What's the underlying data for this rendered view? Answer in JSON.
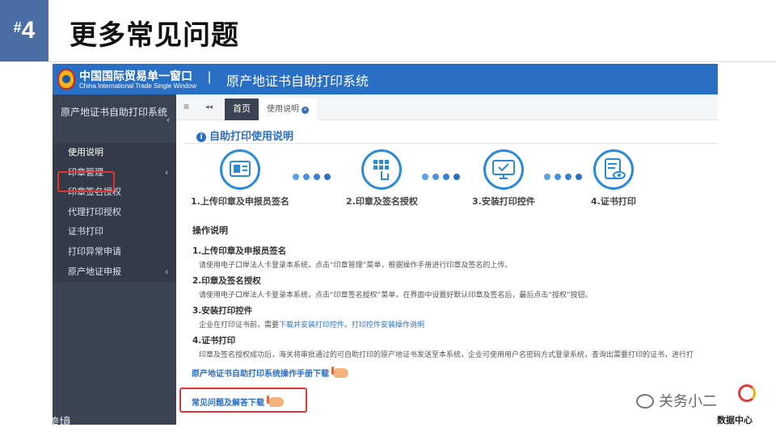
{
  "slide": {
    "hash": "#",
    "number": "4",
    "title": "更多常见问题"
  },
  "app": {
    "brand_cn": "中国国际贸易单一窗口",
    "brand_en": "China International Trade Single Window",
    "separator": "|",
    "system_title": "原产地证书自助打印系统"
  },
  "sidebar": {
    "header": "原产地证书自助打印系统",
    "items": [
      {
        "label": "使用说明",
        "chevron": false
      },
      {
        "label": "印章管理",
        "chevron": true
      },
      {
        "label": "印章签名授权",
        "chevron": false
      },
      {
        "label": "代理打印授权",
        "chevron": false
      },
      {
        "label": "证书打印",
        "chevron": false
      },
      {
        "label": "打印异常申请",
        "chevron": false
      },
      {
        "label": "原产地证申报",
        "chevron": true
      }
    ]
  },
  "tabs": {
    "menu_icon": "≡",
    "back_icon": "◂◂",
    "home": "首页",
    "doc": "使用说明",
    "close": "×"
  },
  "panel": {
    "heading": "自助打印使用说明",
    "info_icon": "i"
  },
  "steps": [
    {
      "label": "1.上传印章及申报员签名",
      "icon": "upload-seal-icon"
    },
    {
      "label": "2.印章及签名授权",
      "icon": "authorize-touch-icon"
    },
    {
      "label": "3.安装打印控件",
      "icon": "install-monitor-icon"
    },
    {
      "label": "4.证书打印",
      "icon": "certificate-print-icon"
    }
  ],
  "ops": {
    "title": "操作说明",
    "s1_title": "1.上传印章及申报员签名",
    "s1_text": "请使用电子口岸法人卡登录本系统，点击“印章管理”菜单，根据操作手册进行印章及签名的上传。",
    "s2_title": "2.印章及签名授权",
    "s2_text": "请使用电子口岸法人卡登录本系统，点击“印章签名授权”菜单，在界面中设置好默认印章及签名后，最后点击“授权”按钮。",
    "s3_title": "3.安装打印控件",
    "s3_pre": "企业在打印证书前，需要",
    "s3_link1": "下载并安装打印控件",
    "s3_sep": "。",
    "s3_link2": "打印控件安装操作说明",
    "s4_title": "4.证书打印",
    "s4_text": "印章及签名授权成功后，海关将审批通过的可自助打印的原产地证书发送至本系统，企业可使用用户名密码方式登录系统，查询出需要打印的证书，进行打"
  },
  "links": {
    "manual": "原产地证书自助打印系统操作手册下载",
    "faq": "常见问题及解答下载"
  },
  "watermarks": {
    "left": "大数跨境",
    "right": "关务小二",
    "data_center": "数据中心"
  },
  "colors": {
    "brand_blue": "#2a6fc6",
    "sidebar_bg": "#3b4252",
    "highlight_red": "#e33232",
    "badge_blue": "#4a6fa5"
  }
}
